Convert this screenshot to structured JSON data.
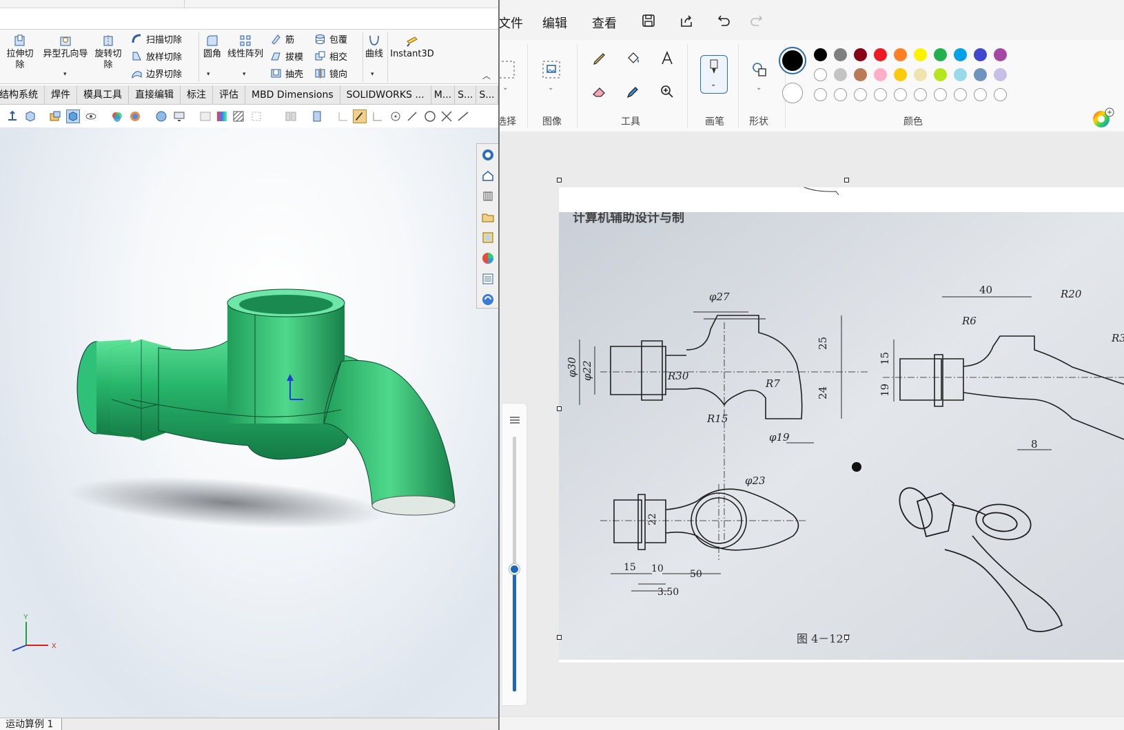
{
  "solidworks": {
    "ribbon": {
      "extrude_cut": "拉伸切除",
      "hole_wizard": "异型孔向导",
      "revolve_cut": "旋转切除",
      "swept_cut": "扫描切除",
      "lofted_cut": "放样切除",
      "boundary_cut": "边界切除",
      "fillet": "圆角",
      "linear_pattern": "线性阵列",
      "rib": "筋",
      "draft": "拔模",
      "shell": "抽壳",
      "wrap": "包覆",
      "intersect": "相交",
      "mirror": "镜向",
      "curves": "曲线",
      "instant3d": "Instant3D"
    },
    "tabs": [
      "结构系统",
      "焊件",
      "模具工具",
      "直接编辑",
      "标注",
      "评估",
      "MBD Dimensions",
      "SOLIDWORKS ...",
      "M...",
      "S...",
      "S..."
    ],
    "bottom_tab": "运动算例 1",
    "triad": {
      "y": "Y",
      "x": "X"
    }
  },
  "paint": {
    "menu": {
      "file": "文件",
      "edit": "编辑",
      "view": "查看"
    },
    "groups": {
      "select": "选择",
      "image": "图像",
      "tools": "工具",
      "brushes": "画笔",
      "shapes": "形状",
      "colors": "颜色"
    },
    "palette_row1": [
      "#000000",
      "#7f7f7f",
      "#880015",
      "#ed1c24",
      "#ff7f27",
      "#fff200",
      "#22b14c",
      "#00a2e8",
      "#3f48cc",
      "#a349a4"
    ],
    "palette_row2": [
      "#ffffff",
      "#c3c3c3",
      "#b97a57",
      "#ffaec9",
      "#ffc90e",
      "#efe4b0",
      "#b5e61d",
      "#99d9ea",
      "#7092be",
      "#c8bfe7"
    ],
    "primary_color": "#000000",
    "secondary_color": "#ffffff",
    "drawing": {
      "header_text": "计算机辅助设计与制",
      "dims": {
        "d27": "φ27",
        "d30": "φ30",
        "d22": "φ22",
        "r30": "R30",
        "r7": "R7",
        "r15": "R15",
        "d19": "φ19",
        "d25": "25",
        "d24": "24",
        "d40": "40",
        "r20": "R20",
        "r6": "R6",
        "r3": "R3",
        "d15": "15",
        "d19b": "19",
        "d8": "8",
        "d23": "φ23",
        "d22b": "22",
        "b15": "15",
        "b10": "10",
        "b50": "50",
        "b350": "3.50"
      },
      "caption": "图  4－127"
    }
  }
}
